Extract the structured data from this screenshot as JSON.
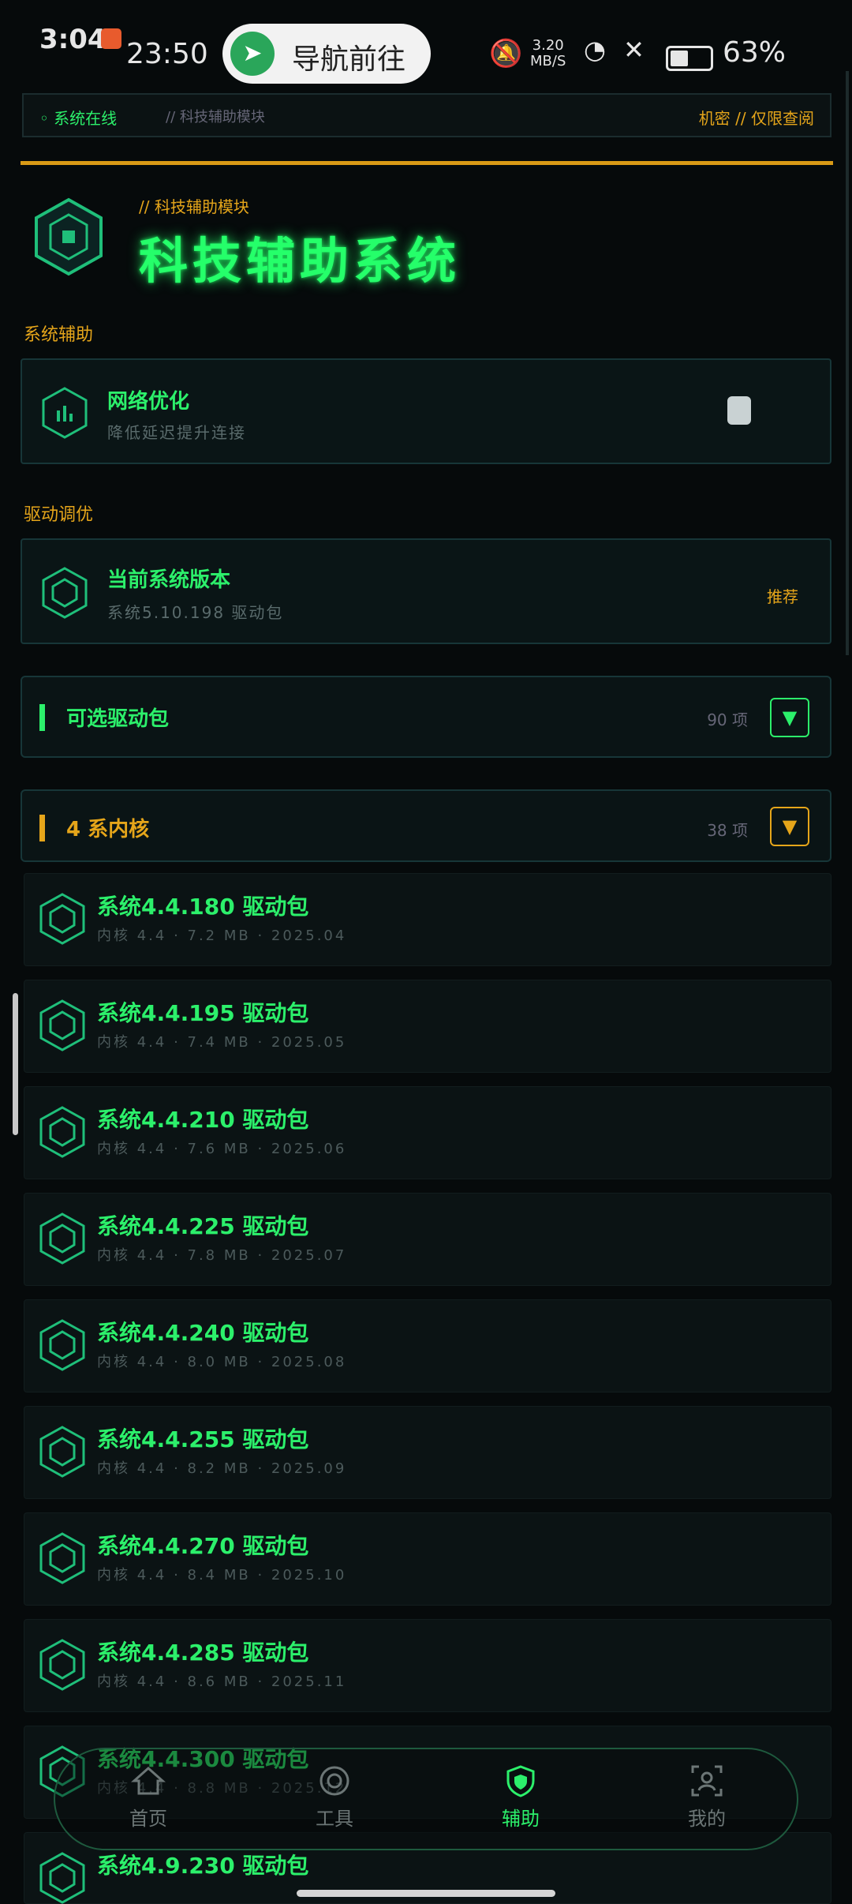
{
  "status_bar": {
    "time": "3:04",
    "clock": "23:50",
    "nav_pill": "导航前往",
    "speed_value": "3.20",
    "speed_unit": "MB/S",
    "battery_percent": "63%"
  },
  "topbar": {
    "left_status": "系统在线",
    "left_module": "// 科技辅助模块",
    "right": "机密 // 仅限查阅"
  },
  "hero": {
    "subtitle": "// 科技辅助模块",
    "title": "科技辅助系统"
  },
  "sections": {
    "assist": "系统辅助",
    "driver": "驱动调优"
  },
  "network_card": {
    "title": "网络优化",
    "desc": "降低延迟提升连接"
  },
  "version_card": {
    "title": "当前系统版本",
    "desc": "系统5.10.198 驱动包",
    "tag": "推荐"
  },
  "optional_group": {
    "title": "可选驱动包",
    "count": "90 项"
  },
  "kernel_group": {
    "title": "4 系内核",
    "count": "38 项"
  },
  "driver_items": [
    {
      "title": "系统4.4.180 驱动包",
      "desc": "内核 4.4 · 7.2 MB · 2025.04"
    },
    {
      "title": "系统4.4.195 驱动包",
      "desc": "内核 4.4 · 7.4 MB · 2025.05"
    },
    {
      "title": "系统4.4.210 驱动包",
      "desc": "内核 4.4 · 7.6 MB · 2025.06"
    },
    {
      "title": "系统4.4.225 驱动包",
      "desc": "内核 4.4 · 7.8 MB · 2025.07"
    },
    {
      "title": "系统4.4.240 驱动包",
      "desc": "内核 4.4 · 8.0 MB · 2025.08"
    },
    {
      "title": "系统4.4.255 驱动包",
      "desc": "内核 4.4 · 8.2 MB · 2025.09"
    },
    {
      "title": "系统4.4.270 驱动包",
      "desc": "内核 4.4 · 8.4 MB · 2025.10"
    },
    {
      "title": "系统4.4.285 驱动包",
      "desc": "内核 4.4 · 8.6 MB · 2025.11"
    },
    {
      "title": "系统4.4.300 驱动包",
      "desc": "内核 4.4 · 8.8 MB · 2025.12"
    },
    {
      "title": "系统4.9.230 驱动包",
      "desc": ""
    }
  ],
  "bottom_nav": {
    "home": "首页",
    "tools": "工具",
    "assist": "辅助",
    "mine": "我的"
  },
  "colors": {
    "accent_green": "#2cf06b",
    "accent_gold": "#e5a51a",
    "background": "#060a0b"
  }
}
